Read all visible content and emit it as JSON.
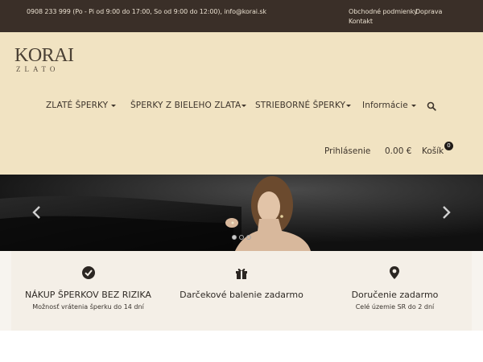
{
  "topbar": {
    "contact": "0908 233 999 (Po - Pi od 9:00 do 17:00, So od 9:00 do 12:00), info@korai.sk",
    "links": [
      "Obchodné podmienky",
      "Doprava",
      "Kontakt"
    ]
  },
  "logo": {
    "brand": "KORAI",
    "sub": "ZLATO"
  },
  "nav": {
    "items": [
      "ZLATÉ ŠPERKY",
      "ŠPERKY Z BIELEHO ZLATA",
      "STRIEBORNÉ ŠPERKY",
      "Informácie"
    ],
    "search_icon": "search-icon"
  },
  "account": {
    "login": "Prihlásenie",
    "total": "0.00 €",
    "cart": "Košík",
    "cart_count": "0"
  },
  "slider": {
    "slides": 3,
    "active_slide": 1
  },
  "features": [
    {
      "icon": "check-circle-icon",
      "title": "NÁKUP ŠPERKOV BEZ RIZIKA",
      "subtitle": "Možnosť vrátenia šperku do 14 dní"
    },
    {
      "icon": "gift-icon",
      "title": "Darčekové balenie zadarmo",
      "subtitle": ""
    },
    {
      "icon": "map-marker-icon",
      "title": "Doručenie zadarmo",
      "subtitle": "Celé územie SR do 2 dní"
    }
  ],
  "colors": {
    "topbar": "#3a2f28",
    "header": "#f1e3c2",
    "hero": "#141414",
    "features": "#f4efe7"
  }
}
